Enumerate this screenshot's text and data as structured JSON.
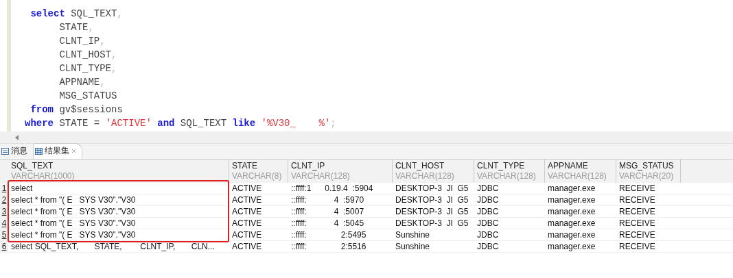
{
  "editor": {
    "lines": [
      [
        {
          "kind": "keyword",
          "text": " select"
        },
        {
          "kind": "plain",
          "text": " SQL_TEXT"
        },
        {
          "kind": "punct",
          "text": ","
        }
      ],
      [
        {
          "kind": "plain",
          "text": "      STATE"
        },
        {
          "kind": "punct",
          "text": ","
        }
      ],
      [
        {
          "kind": "plain",
          "text": "      CLNT_IP"
        },
        {
          "kind": "punct",
          "text": ","
        }
      ],
      [
        {
          "kind": "plain",
          "text": "      CLNT_HOST"
        },
        {
          "kind": "punct",
          "text": ","
        }
      ],
      [
        {
          "kind": "plain",
          "text": "      CLNT_TYPE"
        },
        {
          "kind": "punct",
          "text": ","
        }
      ],
      [
        {
          "kind": "plain",
          "text": "      APPNAME"
        },
        {
          "kind": "punct",
          "text": ","
        }
      ],
      [
        {
          "kind": "plain",
          "text": "      MSG_STATUS"
        }
      ],
      [
        {
          "kind": "keyword",
          "text": " from"
        },
        {
          "kind": "plain",
          "text": " gv$sessions"
        }
      ],
      [
        {
          "kind": "keyword",
          "text": "where"
        },
        {
          "kind": "plain",
          "text": " STATE = "
        },
        {
          "kind": "string",
          "text": "'ACTIVE'"
        },
        {
          "kind": "keyword",
          "text": " and"
        },
        {
          "kind": "plain",
          "text": " SQL_TEXT "
        },
        {
          "kind": "keyword",
          "text": "like"
        },
        {
          "kind": "string",
          "text": " '%V30_    %'"
        },
        {
          "kind": "punct",
          "text": ";"
        }
      ]
    ]
  },
  "tabs": [
    {
      "label": "消息",
      "selected": false
    },
    {
      "label": "结果集",
      "selected": true
    }
  ],
  "table": {
    "columns": [
      {
        "name": "SQL_TEXT",
        "type": "VARCHAR(1000)"
      },
      {
        "name": "STATE",
        "type": "VARCHAR(8)"
      },
      {
        "name": "CLNT_IP",
        "type": "VARCHAR(128)"
      },
      {
        "name": "CLNT_HOST",
        "type": "VARCHAR(128)"
      },
      {
        "name": "CLNT_TYPE",
        "type": "VARCHAR(128)"
      },
      {
        "name": "APPNAME",
        "type": "VARCHAR(128)"
      },
      {
        "name": "MSG_STATUS",
        "type": "VARCHAR(20)"
      }
    ],
    "rows": [
      {
        "number": "1",
        "cells": [
          "select",
          "ACTIVE",
          "::ffff:1      0.19.4  :5904",
          "DESKTOP-3  JI  G5",
          "JDBC",
          "manager.exe",
          "RECEIVE"
        ]
      },
      {
        "number": "2",
        "cells": [
          "select * from \"( E   SYS V30\".\"V30",
          "ACTIVE",
          "::ffff:            4  :5970",
          "DESKTOP-3  JI  G5",
          "JDBC",
          "manager.exe",
          "RECEIVE"
        ]
      },
      {
        "number": "3",
        "cells": [
          "select * from \"( E   SYS V30\".\"V30",
          "ACTIVE",
          "::ffff:            4  :5007",
          "DESKTOP-3  JI  G5",
          "JDBC",
          "manager.exe",
          "RECEIVE"
        ]
      },
      {
        "number": "4",
        "cells": [
          "select * from \"( E   SYS V30\".\"V30",
          "ACTIVE",
          "::ffff:            4  :5045",
          "DESKTOP-3  JI  G5",
          "JDBC",
          "manager.exe",
          "RECEIVE"
        ]
      },
      {
        "number": "5",
        "cells": [
          "select * from \"( E   SYS V30\".\"V30",
          "ACTIVE",
          "::ffff:               2:5495",
          "Sunshine",
          "JDBC",
          "manager.exe",
          "RECEIVE"
        ]
      },
      {
        "number": "6",
        "cells": [
          "select SQL_TEXT,       STATE,        CLNT_IP,       CLN...",
          "ACTIVE",
          "::ffff:               2:5516",
          "Sunshine",
          "JDBC",
          "manager.exe",
          "RECEIVE"
        ]
      }
    ]
  }
}
